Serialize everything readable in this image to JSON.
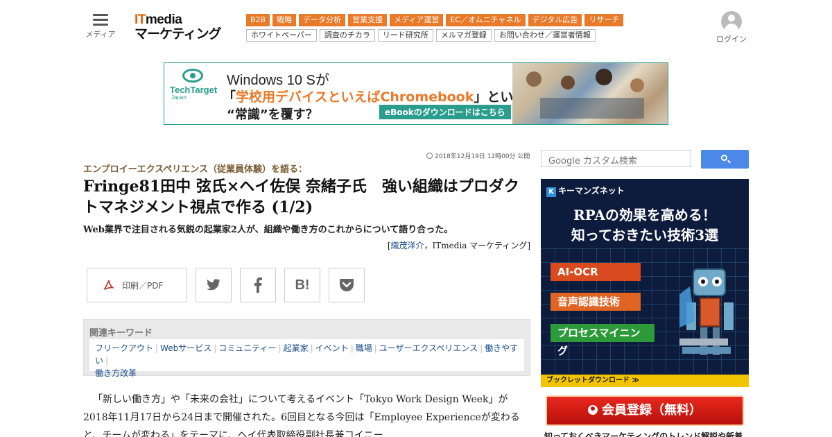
{
  "header": {
    "menu_label": "メディア",
    "logo_top_it": "IT",
    "logo_top_rest": "media",
    "logo_bottom": "マーケティング",
    "nav_primary": [
      "B2B",
      "戦略",
      "データ分析",
      "営業支援",
      "メディア運営",
      "EC／オムニチャネル",
      "デジタル広告",
      "リサーチ"
    ],
    "nav_secondary": [
      "ホワイトペーパー",
      "調査のチカラ",
      "リード研究所",
      "メルマガ登録",
      "お問い合わせ／運営者情報"
    ],
    "login_label": "ログイン",
    "accent_color": "#e97a2a"
  },
  "banner": {
    "brand": "TechTarget",
    "brand_sub": "Japan",
    "line1": "Windows 10 Sが",
    "line2_open": "「",
    "line2_highlight": "学校用デバイスといえばChromebook",
    "line2_close": "」という",
    "line3": "“常識”を覆す？",
    "cta": "eBookのダウンロードはこちら",
    "brand_color": "#2a9d8f"
  },
  "article": {
    "timestamp": "2018年12月19日 12時00分 公開",
    "kicker": "エンプロイーエクスペリエンス（従業員体験）を語る：",
    "title": "Fringe81田中 弦氏×ヘイ佐俣 奈緒子氏　強い組織はプロダクトマネジメント視点で作る (1/2)",
    "lead": "Web業界で注目される気鋭の起業家2人が、組織や働き方のこれからについて語り合った。",
    "byline_open": "[",
    "byline_author": "織茂洋介",
    "byline_sep": "，",
    "byline_outlet": "ITmedia マーケティング",
    "byline_close": "]",
    "body": "「新しい働き方」や「未来の会社」について考えるイベント「Tokyo Work Design Week」が2018年11月17日から24日まで開催された。6回目となる今回は「Employee Experienceが変わると、チームが変わる」をテーマに、ヘイ代表取締役副社長兼コイニー"
  },
  "share": {
    "pdf_label": "印刷／PDF",
    "twitter_icon": "twitter-icon",
    "facebook_icon": "facebook-icon",
    "hatena_icon": "hatena-icon",
    "pocket_icon": "pocket-icon"
  },
  "keywords": {
    "heading": "関連キーワード",
    "items": [
      "フリークアウト",
      "Webサービス",
      "コミュニティー",
      "起業家",
      "イベント",
      "職場",
      "ユーザーエクスペリエンス",
      "働きやすい",
      "働き方改革"
    ]
  },
  "search": {
    "placeholder": "Google カスタム検索"
  },
  "side_ad": {
    "brand": "キーマンズネット",
    "headline_1": "RPAの効果を高める！",
    "headline_2": "知っておきたい技術3選",
    "tags": [
      "AI-OCR",
      "音声認識技術",
      "プロセスマイニング"
    ],
    "footer": "ブックレットダウンロード ≫"
  },
  "register": {
    "label": "会員登録（無料）"
  },
  "promo": "知っておくべきマーケティングのトレンド解説や新着"
}
